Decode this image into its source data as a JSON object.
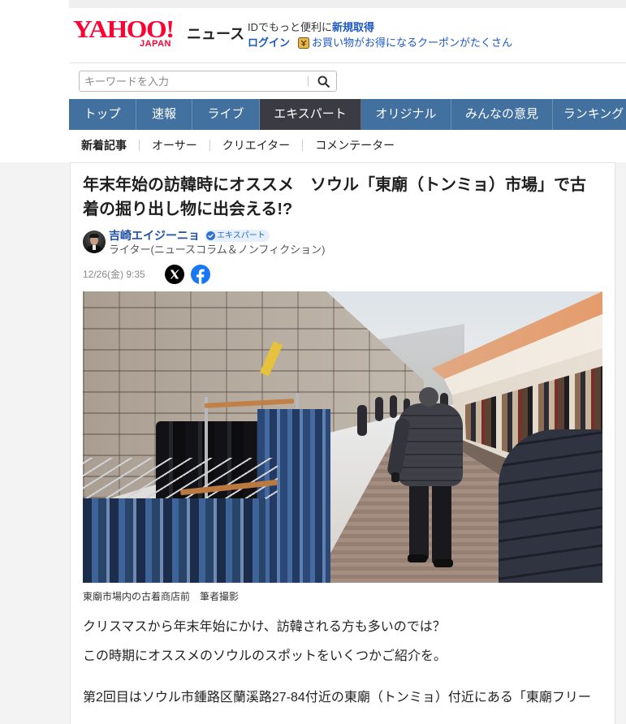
{
  "header": {
    "logo": {
      "main": "YAHOO!",
      "sub": "JAPAN",
      "service": "ニュース"
    },
    "account": {
      "prompt": "IDでもっと便利に",
      "signup_link": "新規取得",
      "login_link": "ログイン",
      "coupon_icon": "coupon-icon",
      "coupon_text": "お買い物がお得になるクーポンがたくさん"
    },
    "search": {
      "placeholder": "キーワードを入力",
      "value": "",
      "icon": "search-icon"
    },
    "nav": [
      {
        "label": "トップ",
        "active": false
      },
      {
        "label": "速報",
        "active": false
      },
      {
        "label": "ライブ",
        "active": false
      },
      {
        "label": "エキスパート",
        "active": true
      },
      {
        "label": "オリジナル",
        "active": false
      },
      {
        "label": "みんなの意見",
        "active": false
      },
      {
        "label": "ランキング",
        "active": false
      }
    ],
    "subnav": [
      {
        "label": "新着記事",
        "active": true
      },
      {
        "label": "オーサー",
        "active": false
      },
      {
        "label": "クリエイター",
        "active": false
      },
      {
        "label": "コメンテーター",
        "active": false
      }
    ]
  },
  "article": {
    "title": "年末年始の訪韓時にオススメ　ソウル「東廟（トンミョ）市場」で古着の掘り出し物に出会える!?",
    "author": {
      "name": "吉崎エイジーニョ",
      "badge": "エキスパート",
      "badge_icon": "check-circle-icon",
      "role": "ライター(ニュースコラム＆ノンフィクション)"
    },
    "published": "12/26(金) 9:35",
    "share": [
      {
        "service": "X",
        "icon": "x-logo-icon"
      },
      {
        "service": "Facebook",
        "icon": "facebook-icon"
      }
    ],
    "photo": {
      "caption": "東廟市場内の古着商店前　筆者撮影"
    },
    "paragraphs": [
      "クリスマスから年末年始にかけ、訪韓される方も多いのでは？",
      "この時期にオススメのソウルのスポットをいくつかご紹介を。",
      "第2回目はソウル市鍾路区蘭溪路27-84付近の東廟（トンミョ）付近にある「東廟フリー"
    ]
  },
  "colors": {
    "logo_red": "#ff0033",
    "link_blue": "#1b58c6",
    "author_blue": "#1e4fa6",
    "nav_bg": "#43719f",
    "nav_active_bg": "#3b3b43",
    "badge_bg": "#e6f0fc",
    "badge_blue": "#2c6ac9",
    "x_black": "#000000",
    "facebook_blue": "#1877f2",
    "text_muted": "#888888"
  }
}
